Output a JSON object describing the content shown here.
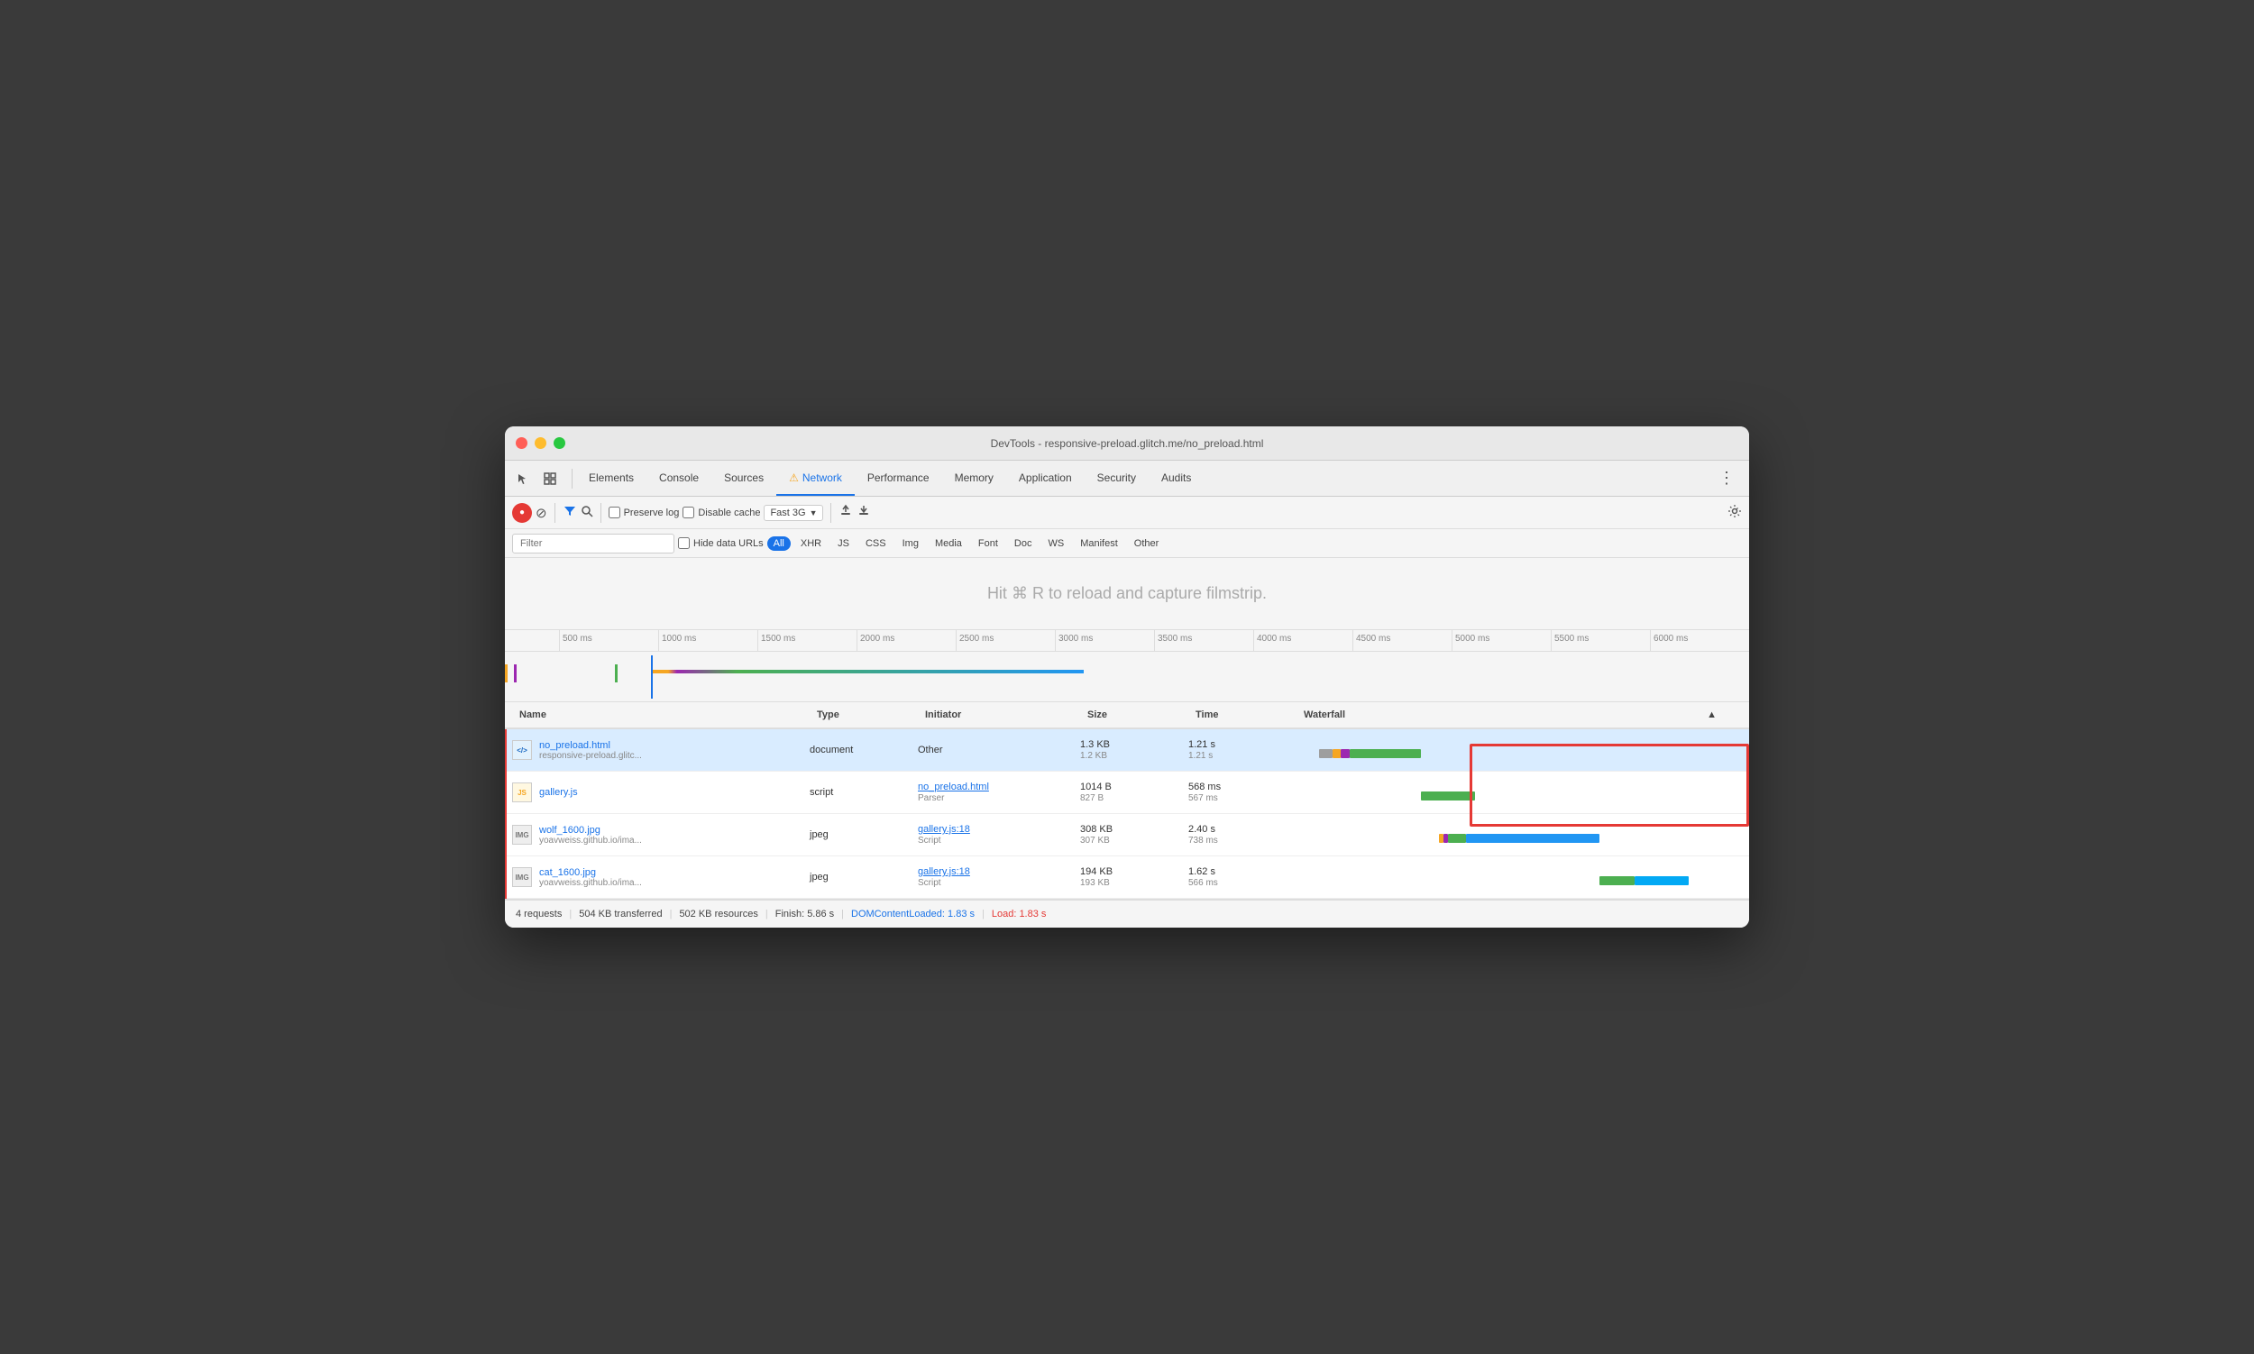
{
  "window": {
    "title": "DevTools - responsive-preload.glitch.me/no_preload.html"
  },
  "tabs": {
    "items": [
      {
        "label": "Elements",
        "active": false
      },
      {
        "label": "Console",
        "active": false
      },
      {
        "label": "Sources",
        "active": false
      },
      {
        "label": "Network",
        "active": true,
        "warning": true
      },
      {
        "label": "Performance",
        "active": false
      },
      {
        "label": "Memory",
        "active": false
      },
      {
        "label": "Application",
        "active": false
      },
      {
        "label": "Security",
        "active": false
      },
      {
        "label": "Audits",
        "active": false
      }
    ]
  },
  "toolbar": {
    "preserve_log": "Preserve log",
    "disable_cache": "Disable cache",
    "throttle": "Fast 3G"
  },
  "filter_bar": {
    "filter_placeholder": "Filter",
    "hide_data_urls": "Hide data URLs",
    "types": [
      "All",
      "XHR",
      "JS",
      "CSS",
      "Img",
      "Media",
      "Font",
      "Doc",
      "WS",
      "Manifest",
      "Other"
    ]
  },
  "filmstrip": {
    "text": "Hit ⌘ R to reload and capture filmstrip."
  },
  "ruler": {
    "ticks": [
      "500 ms",
      "1000 ms",
      "1500 ms",
      "2000 ms",
      "2500 ms",
      "3000 ms",
      "3500 ms",
      "4000 ms",
      "4500 ms",
      "5000 ms",
      "5500 ms",
      "6000 ms"
    ]
  },
  "table": {
    "headers": [
      "Name",
      "Type",
      "Initiator",
      "Size",
      "Time",
      "Waterfall"
    ],
    "rows": [
      {
        "name": "no_preload.html",
        "url": "responsive-preload.glitc...",
        "icon": "HTML",
        "type": "document",
        "initiator": "Other",
        "initiator_link": false,
        "size1": "1.3 KB",
        "size2": "1.2 KB",
        "time1": "1.21 s",
        "time2": "1.21 s",
        "selected": true
      },
      {
        "name": "gallery.js",
        "url": "",
        "icon": "JS",
        "type": "script",
        "initiator": "no_preload.html",
        "initiator2": "Parser",
        "initiator_link": true,
        "size1": "1014 B",
        "size2": "827 B",
        "time1": "568 ms",
        "time2": "567 ms",
        "selected": false
      },
      {
        "name": "wolf_1600.jpg",
        "url": "yoavweiss.github.io/ima...",
        "icon": "IMG",
        "type": "jpeg",
        "initiator": "gallery.js:18",
        "initiator2": "Script",
        "initiator_link": true,
        "size1": "308 KB",
        "size2": "307 KB",
        "time1": "2.40 s",
        "time2": "738 ms",
        "selected": false
      },
      {
        "name": "cat_1600.jpg",
        "url": "yoavweiss.github.io/ima...",
        "icon": "IMG",
        "type": "jpeg",
        "initiator": "gallery.js:18",
        "initiator2": "Script",
        "initiator_link": true,
        "size1": "194 KB",
        "size2": "193 KB",
        "time1": "1.62 s",
        "time2": "566 ms",
        "selected": false
      }
    ]
  },
  "status": {
    "requests": "4 requests",
    "transferred": "504 KB transferred",
    "resources": "502 KB resources",
    "finish": "Finish: 5.86 s",
    "dom": "DOMContentLoaded: 1.83 s",
    "load": "Load: 1.83 s"
  }
}
